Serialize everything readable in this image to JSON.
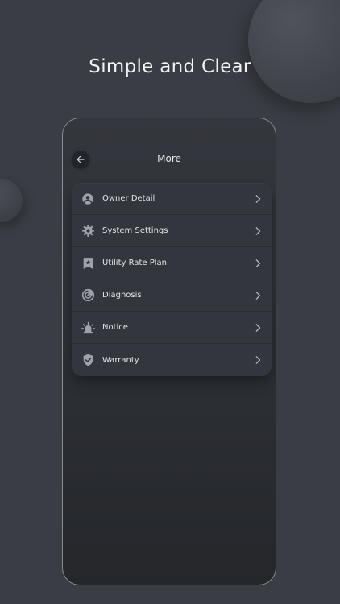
{
  "headline": "Simple and Clear",
  "screen": {
    "title": "More",
    "back_icon": "arrow-left-icon"
  },
  "menu": {
    "items": [
      {
        "label": "Owner Detail",
        "icon": "user-circle-icon"
      },
      {
        "label": "System Settings",
        "icon": "gear-icon"
      },
      {
        "label": "Utility Rate Plan",
        "icon": "bookmark-plan-icon"
      },
      {
        "label": "Diagnosis",
        "icon": "radar-icon"
      },
      {
        "label": "Notice",
        "icon": "alarm-siren-icon"
      },
      {
        "label": "Warranty",
        "icon": "shield-check-icon"
      }
    ]
  },
  "colors": {
    "background": "#3a3d44",
    "card": "#33363c",
    "text": "#e3e5e8",
    "icon": "#9ea2aa"
  }
}
